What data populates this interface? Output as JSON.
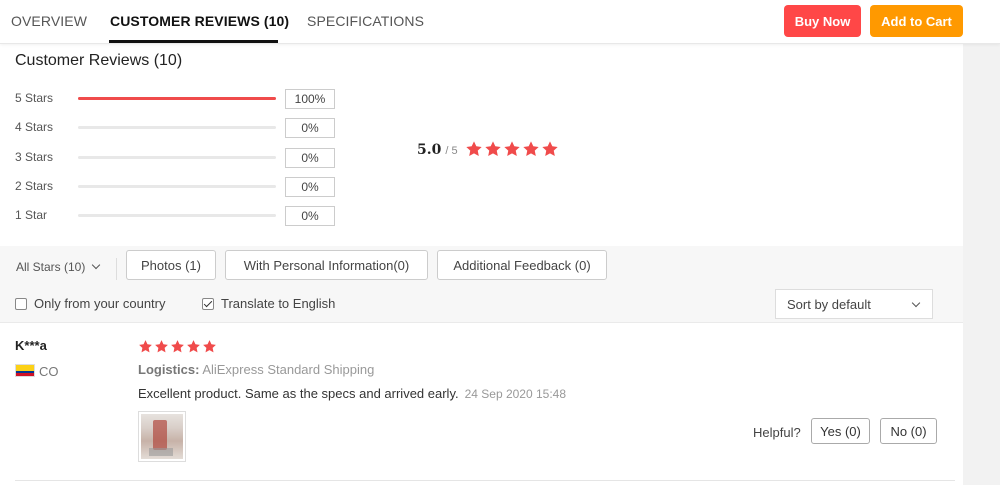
{
  "tabs": [
    {
      "label": "OVERVIEW",
      "active": false
    },
    {
      "label": "CUSTOMER REVIEWS (10)",
      "active": true
    },
    {
      "label": "SPECIFICATIONS",
      "active": false
    }
  ],
  "actions": {
    "buy_now": "Buy Now",
    "add_to_cart": "Add to Cart"
  },
  "summary": {
    "title": "Customer Reviews (10)",
    "distribution": [
      {
        "label": "5 Stars",
        "percent_text": "100%",
        "fraction": 1.0
      },
      {
        "label": "4 Stars",
        "percent_text": "0%",
        "fraction": 0
      },
      {
        "label": "3 Stars",
        "percent_text": "0%",
        "fraction": 0
      },
      {
        "label": "2 Stars",
        "percent_text": "0%",
        "fraction": 0
      },
      {
        "label": "1 Star",
        "percent_text": "0%",
        "fraction": 0
      }
    ],
    "average": "5.0",
    "out_of": "/ 5",
    "stars": 5
  },
  "filters": {
    "all_stars": "All Stars (10)",
    "buttons": [
      "Photos (1)",
      "With Personal Information(0)",
      "Additional Feedback (0)"
    ],
    "only_country": {
      "label": "Only from your country",
      "checked": false
    },
    "translate": {
      "label": "Translate to English",
      "checked": true
    },
    "sort": "Sort by default"
  },
  "review": {
    "name": "K***a",
    "country": "CO",
    "stars": 5,
    "logistics_label": "Logistics:",
    "logistics_value": "AliExpress Standard Shipping",
    "text": "Excellent product. Same as the specs and arrived early.",
    "date": "24 Sep 2020 15:48",
    "helpful": "Helpful?",
    "yes": "Yes (0)",
    "no": "No (0)"
  },
  "colors": {
    "accent_red": "#ff4747",
    "accent_orange": "#ff9900",
    "star": "#f04b4b"
  }
}
